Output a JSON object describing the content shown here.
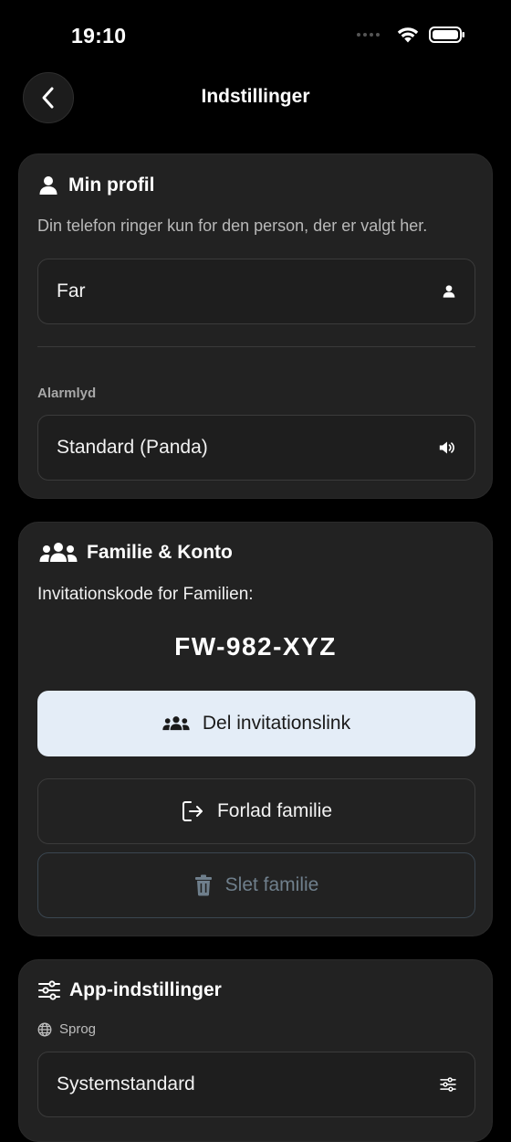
{
  "status": {
    "time": "19:10"
  },
  "header": {
    "title": "Indstillinger"
  },
  "profile": {
    "title": "Min profil",
    "description": "Din telefon ringer kun for den person, der er valgt her.",
    "person_value": "Far",
    "alarm_label": "Alarmlyd",
    "alarm_value": "Standard (Panda)"
  },
  "family": {
    "title": "Familie & Konto",
    "invite_label": "Invitationskode for Familien:",
    "invite_code": "FW-982-XYZ",
    "share_label": "Del invitationslink",
    "leave_label": "Forlad familie",
    "delete_label": "Slet familie"
  },
  "app_settings": {
    "title": "App-indstillinger",
    "language_label": "Sprog",
    "language_value": "Systemstandard"
  },
  "colors": {
    "background": "#000000",
    "card": "#222222",
    "primary_button": "#e4edf7",
    "disabled_text": "#6f7f8c"
  }
}
